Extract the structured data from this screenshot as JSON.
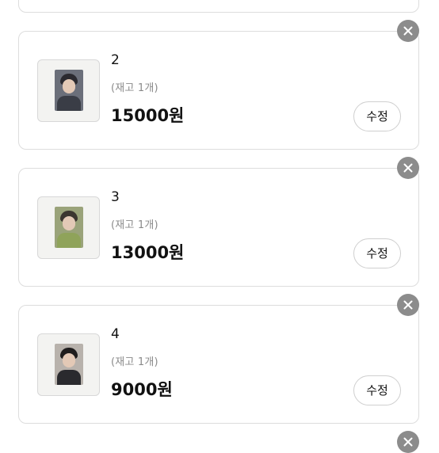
{
  "items": [
    {
      "name": "2",
      "stock": "(재고 1개)",
      "price": "15000원",
      "edit_label": "수정",
      "photo_colors": [
        "#6b6f7a",
        "#2b2a30",
        "#3a3d46"
      ]
    },
    {
      "name": "3",
      "stock": "(재고 1개)",
      "price": "13000원",
      "edit_label": "수정",
      "photo_colors": [
        "#9aa37a",
        "#3b3630",
        "#8fa35a"
      ]
    },
    {
      "name": "4",
      "stock": "(재고 1개)",
      "price": "9000원",
      "edit_label": "수정",
      "photo_colors": [
        "#b8b2ac",
        "#1f1d1d",
        "#2a2a2e"
      ]
    }
  ],
  "colors": {
    "border": "#dddddd",
    "close_button": "#8c8c8c",
    "stock_text": "#8a8a8a"
  },
  "icons": {
    "remove": "close-icon"
  }
}
